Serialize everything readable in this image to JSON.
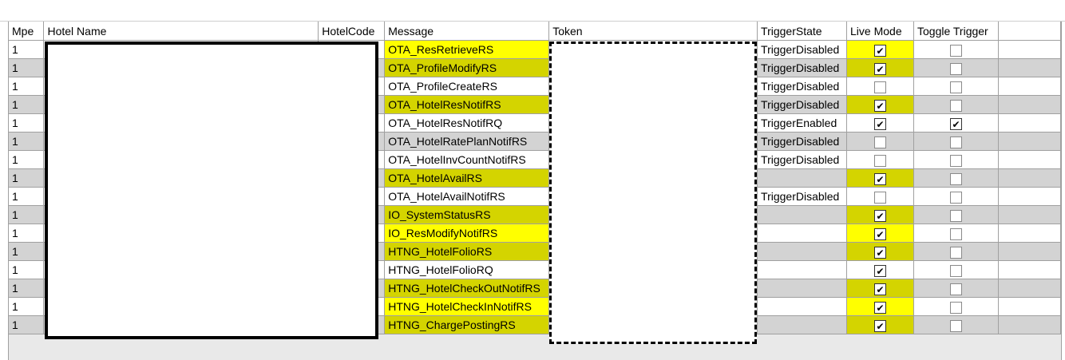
{
  "columns": {
    "mpe": "Mpe",
    "hotel_name": "Hotel Name",
    "hotel_code": "HotelCode",
    "message": "Message",
    "token": "Token",
    "trigger_state": "TriggerState",
    "live_mode": "Live Mode",
    "toggle_trigger": "Toggle Trigger"
  },
  "colors": {
    "highlight": "#ffff00",
    "highlight_on_alt_row": "#d4d400",
    "alt_row": "#d3d3d3",
    "grid_line": "#a0a0a0"
  },
  "rows": [
    {
      "mpe": "1",
      "message": "OTA_ResRetrieveRS",
      "trigger_state": "TriggerDisabled",
      "live_mode": true,
      "toggle_trigger": false,
      "message_highlight": true,
      "live_highlight": true
    },
    {
      "mpe": "1",
      "message": "OTA_ProfileModifyRS",
      "trigger_state": "TriggerDisabled",
      "live_mode": true,
      "toggle_trigger": false,
      "message_highlight": true,
      "live_highlight": true
    },
    {
      "mpe": "1",
      "message": "OTA_ProfileCreateRS",
      "trigger_state": "TriggerDisabled",
      "live_mode": false,
      "toggle_trigger": false,
      "message_highlight": false,
      "live_highlight": false
    },
    {
      "mpe": "1",
      "message": "OTA_HotelResNotifRS",
      "trigger_state": "TriggerDisabled",
      "live_mode": true,
      "toggle_trigger": false,
      "message_highlight": true,
      "live_highlight": true
    },
    {
      "mpe": "1",
      "message": "OTA_HotelResNotifRQ",
      "trigger_state": "TriggerEnabled",
      "live_mode": true,
      "toggle_trigger": true,
      "message_highlight": false,
      "live_highlight": false
    },
    {
      "mpe": "1",
      "message": "OTA_HotelRatePlanNotifRS",
      "trigger_state": "TriggerDisabled",
      "live_mode": false,
      "toggle_trigger": false,
      "message_highlight": false,
      "live_highlight": false
    },
    {
      "mpe": "1",
      "message": "OTA_HotelInvCountNotifRS",
      "trigger_state": "TriggerDisabled",
      "live_mode": false,
      "toggle_trigger": false,
      "message_highlight": false,
      "live_highlight": false
    },
    {
      "mpe": "1",
      "message": "OTA_HotelAvailRS",
      "trigger_state": "",
      "live_mode": true,
      "toggle_trigger": false,
      "message_highlight": true,
      "live_highlight": true
    },
    {
      "mpe": "1",
      "message": "OTA_HotelAvailNotifRS",
      "trigger_state": "TriggerDisabled",
      "live_mode": false,
      "toggle_trigger": false,
      "message_highlight": false,
      "live_highlight": false
    },
    {
      "mpe": "1",
      "message": "IO_SystemStatusRS",
      "trigger_state": "",
      "live_mode": true,
      "toggle_trigger": false,
      "message_highlight": true,
      "live_highlight": true
    },
    {
      "mpe": "1",
      "message": "IO_ResModifyNotifRS",
      "trigger_state": "",
      "live_mode": true,
      "toggle_trigger": false,
      "message_highlight": true,
      "live_highlight": true
    },
    {
      "mpe": "1",
      "message": "HTNG_HotelFolioRS",
      "trigger_state": "",
      "live_mode": true,
      "toggle_trigger": false,
      "message_highlight": true,
      "live_highlight": true
    },
    {
      "mpe": "1",
      "message": "HTNG_HotelFolioRQ",
      "trigger_state": "",
      "live_mode": true,
      "toggle_trigger": false,
      "message_highlight": false,
      "live_highlight": false
    },
    {
      "mpe": "1",
      "message": "HTNG_HotelCheckOutNotifRS",
      "trigger_state": "",
      "live_mode": true,
      "toggle_trigger": false,
      "message_highlight": true,
      "live_highlight": true
    },
    {
      "mpe": "1",
      "message": "HTNG_HotelCheckInNotifRS",
      "trigger_state": "",
      "live_mode": true,
      "toggle_trigger": false,
      "message_highlight": true,
      "live_highlight": true
    },
    {
      "mpe": "1",
      "message": "HTNG_ChargePostingRS",
      "trigger_state": "",
      "live_mode": true,
      "toggle_trigger": false,
      "message_highlight": true,
      "live_highlight": true
    }
  ]
}
